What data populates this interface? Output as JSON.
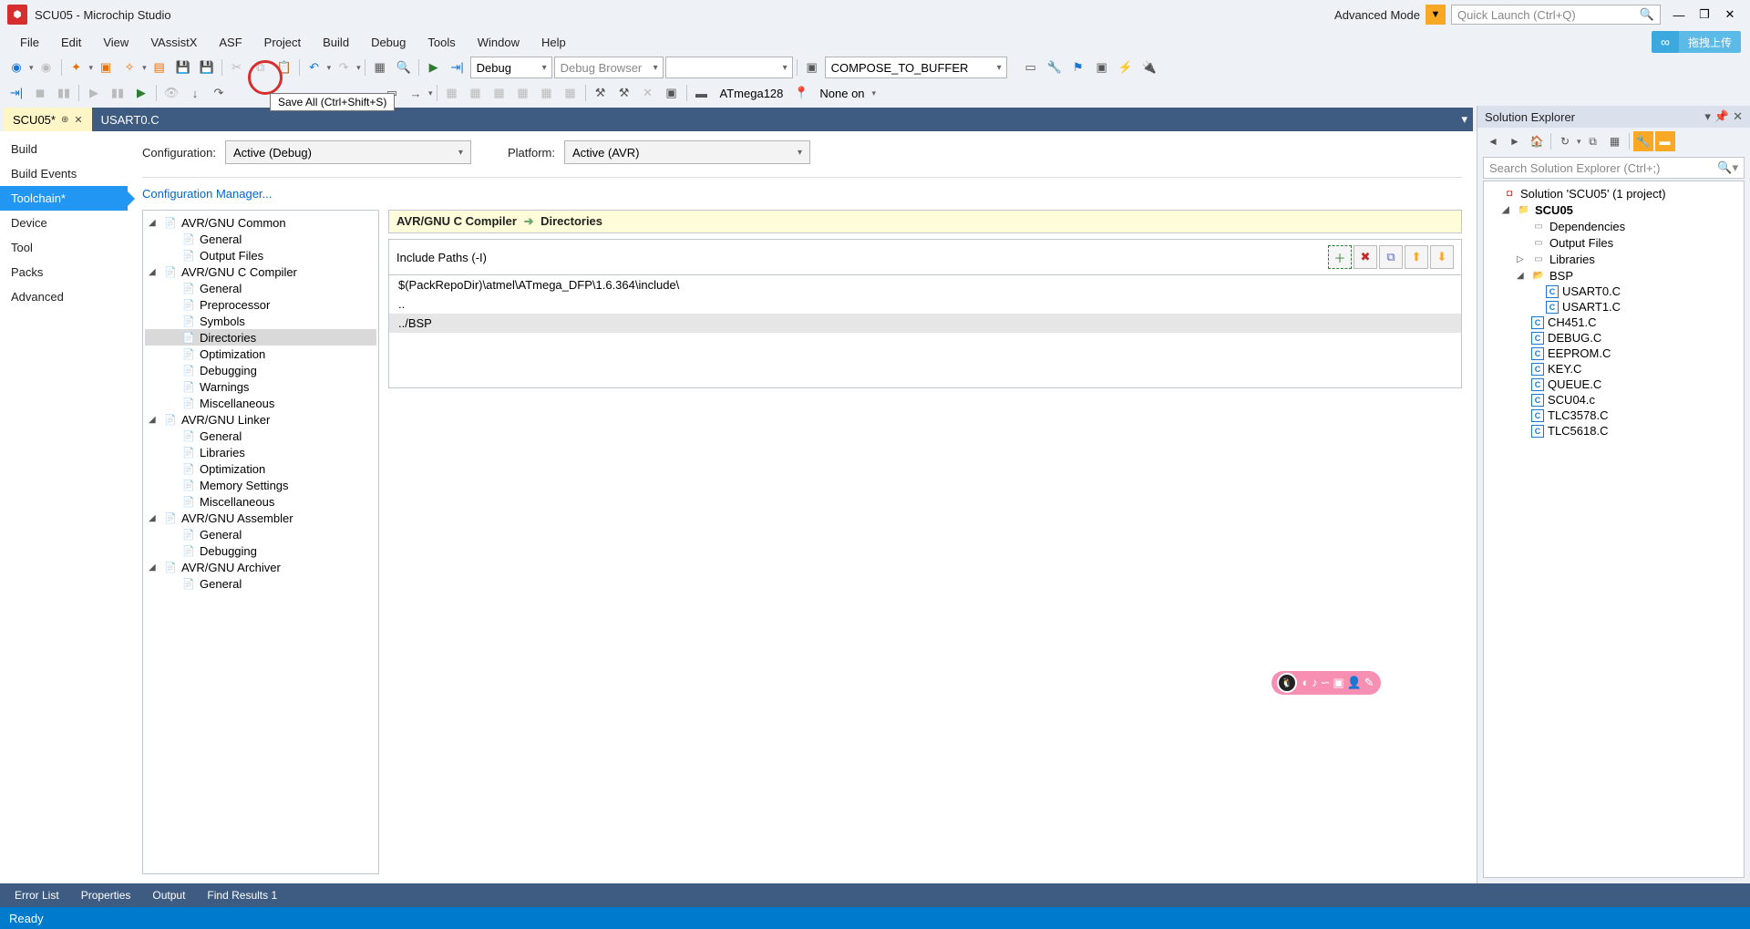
{
  "title": "SCU05 - Microchip Studio",
  "advanced_mode": "Advanced Mode",
  "quick_launch_placeholder": "Quick Launch (Ctrl+Q)",
  "menu": [
    "File",
    "Edit",
    "View",
    "VAssistX",
    "ASF",
    "Project",
    "Build",
    "Debug",
    "Tools",
    "Window",
    "Help"
  ],
  "upload_label": "拖拽上传",
  "toolbar1": {
    "config_combo": "Debug",
    "debug_browser": "Debug Browser",
    "compose": "COMPOSE_TO_BUFFER"
  },
  "toolbar2": {
    "device": "ATmega128",
    "tool": "None on"
  },
  "tooltip": "Save All (Ctrl+Shift+S)",
  "tabs": [
    {
      "label": "SCU05*",
      "active": true
    },
    {
      "label": "USART0.C",
      "active": false
    }
  ],
  "left_nav": [
    "Build",
    "Build Events",
    "Toolchain*",
    "Device",
    "Tool",
    "Packs",
    "Advanced"
  ],
  "left_nav_selected": 2,
  "config_row": {
    "config_label": "Configuration:",
    "config_value": "Active (Debug)",
    "platform_label": "Platform:",
    "platform_value": "Active (AVR)"
  },
  "config_mgr_link": "Configuration Manager...",
  "tc_tree": [
    {
      "label": "AVR/GNU Common",
      "depth": 0,
      "expanded": true,
      "type": "group"
    },
    {
      "label": "General",
      "depth": 1,
      "type": "leaf"
    },
    {
      "label": "Output Files",
      "depth": 1,
      "type": "leaf"
    },
    {
      "label": "AVR/GNU C Compiler",
      "depth": 0,
      "expanded": true,
      "type": "group"
    },
    {
      "label": "General",
      "depth": 1,
      "type": "leaf"
    },
    {
      "label": "Preprocessor",
      "depth": 1,
      "type": "leaf"
    },
    {
      "label": "Symbols",
      "depth": 1,
      "type": "leaf"
    },
    {
      "label": "Directories",
      "depth": 1,
      "type": "leaf",
      "selected": true
    },
    {
      "label": "Optimization",
      "depth": 1,
      "type": "leaf"
    },
    {
      "label": "Debugging",
      "depth": 1,
      "type": "leaf"
    },
    {
      "label": "Warnings",
      "depth": 1,
      "type": "leaf"
    },
    {
      "label": "Miscellaneous",
      "depth": 1,
      "type": "leaf"
    },
    {
      "label": "AVR/GNU Linker",
      "depth": 0,
      "expanded": true,
      "type": "group"
    },
    {
      "label": "General",
      "depth": 1,
      "type": "leaf"
    },
    {
      "label": "Libraries",
      "depth": 1,
      "type": "leaf"
    },
    {
      "label": "Optimization",
      "depth": 1,
      "type": "leaf"
    },
    {
      "label": "Memory Settings",
      "depth": 1,
      "type": "leaf"
    },
    {
      "label": "Miscellaneous",
      "depth": 1,
      "type": "leaf"
    },
    {
      "label": "AVR/GNU Assembler",
      "depth": 0,
      "expanded": true,
      "type": "group"
    },
    {
      "label": "General",
      "depth": 1,
      "type": "leaf"
    },
    {
      "label": "Debugging",
      "depth": 1,
      "type": "leaf"
    },
    {
      "label": "AVR/GNU Archiver",
      "depth": 0,
      "expanded": true,
      "type": "group"
    },
    {
      "label": "General",
      "depth": 1,
      "type": "leaf"
    }
  ],
  "tc_header": {
    "section": "AVR/GNU C Compiler",
    "page": "Directories"
  },
  "include_paths_label": "Include Paths (-I)",
  "include_paths": [
    "$(PackRepoDir)\\atmel\\ATmega_DFP\\1.6.364\\include\\",
    "..",
    "../BSP"
  ],
  "include_selected": 2,
  "solution_explorer": {
    "title": "Solution Explorer",
    "search_placeholder": "Search Solution Explorer (Ctrl+;)",
    "tree": [
      {
        "label": "Solution 'SCU05' (1 project)",
        "depth": 0,
        "icon": "sln",
        "expanded": null
      },
      {
        "label": "SCU05",
        "depth": 1,
        "icon": "proj",
        "bold": true,
        "expanded": true
      },
      {
        "label": "Dependencies",
        "depth": 2,
        "icon": "ref"
      },
      {
        "label": "Output Files",
        "depth": 2,
        "icon": "ref"
      },
      {
        "label": "Libraries",
        "depth": 2,
        "icon": "ref",
        "expanded": false
      },
      {
        "label": "BSP",
        "depth": 2,
        "icon": "folder",
        "expanded": true
      },
      {
        "label": "USART0.C",
        "depth": 3,
        "icon": "c"
      },
      {
        "label": "USART1.C",
        "depth": 3,
        "icon": "c"
      },
      {
        "label": "CH451.C",
        "depth": 2,
        "icon": "c"
      },
      {
        "label": "DEBUG.C",
        "depth": 2,
        "icon": "c"
      },
      {
        "label": "EEPROM.C",
        "depth": 2,
        "icon": "c"
      },
      {
        "label": "KEY.C",
        "depth": 2,
        "icon": "c"
      },
      {
        "label": "QUEUE.C",
        "depth": 2,
        "icon": "c"
      },
      {
        "label": "SCU04.c",
        "depth": 2,
        "icon": "c"
      },
      {
        "label": "TLC3578.C",
        "depth": 2,
        "icon": "c"
      },
      {
        "label": "TLC5618.C",
        "depth": 2,
        "icon": "c"
      }
    ]
  },
  "bottom_tabs": [
    "Error List",
    "Properties",
    "Output",
    "Find Results 1"
  ],
  "status": "Ready"
}
